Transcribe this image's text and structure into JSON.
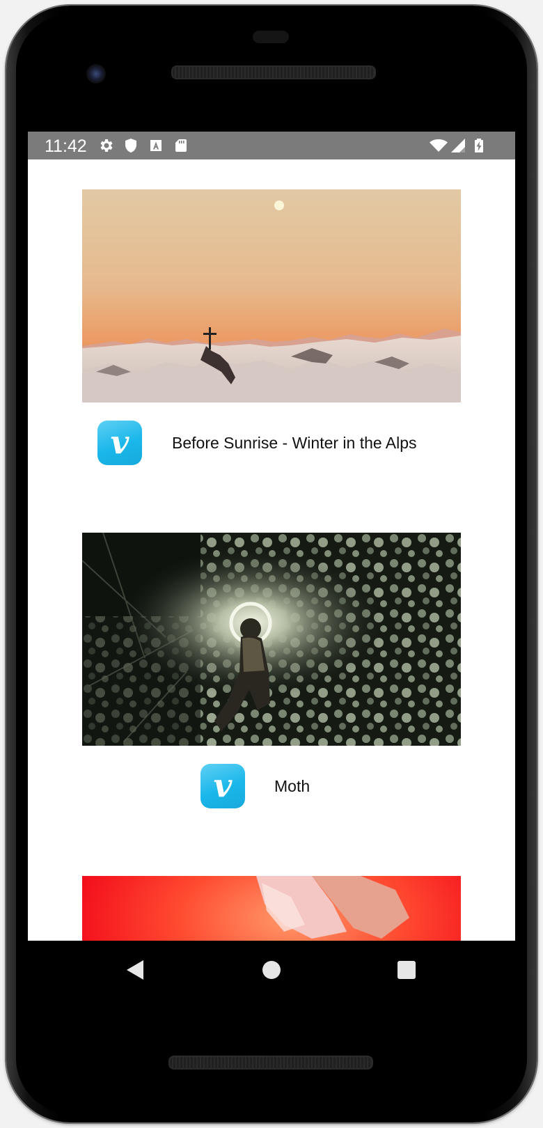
{
  "status_bar": {
    "time": "11:42",
    "left_icons": [
      "settings-icon",
      "shield-icon",
      "font-a-icon",
      "sd-card-icon"
    ],
    "right_icons": [
      "wifi-icon",
      "cell-signal-icon",
      "battery-charging-icon"
    ],
    "background": "#7b7b7b"
  },
  "videos": [
    {
      "title": "Before Sunrise - Winter in the Alps",
      "provider_icon": "vimeo-icon",
      "thumbnail": "snowy mountain summit cross at dawn"
    },
    {
      "title": "Moth",
      "provider_icon": "vimeo-icon",
      "thumbnail": "figure with halo light among night blossoms"
    },
    {
      "title": "",
      "provider_icon": "",
      "thumbnail": "red backdrop with figure in pink fabric"
    }
  ],
  "navigation": {
    "back": "back-icon",
    "home": "home-icon",
    "recents": "recents-icon"
  },
  "colors": {
    "vimeo_blue": "#1ab7ea",
    "status_bar": "#7b7b7b"
  }
}
